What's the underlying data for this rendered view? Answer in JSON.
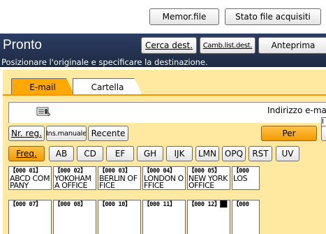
{
  "toolbar": {
    "memor_file": "Memor.file",
    "stato_file": "Stato file acquisiti"
  },
  "header": {
    "title": "Pronto",
    "instruction": "Posizionare l'originale e specificare la destinazione.",
    "cerca_dest": "Cerca dest.",
    "camb_list_dest": "Camb.list.dest.",
    "anteprima": "Anteprima"
  },
  "tabs": [
    {
      "label": "E-mail",
      "active": true
    },
    {
      "label": "Cartella",
      "active": false
    }
  ],
  "destination": {
    "address_label": "Indirizzo e-ma",
    "scroll_glyph": "I"
  },
  "actions": {
    "nr_reg": "Nr. reg.",
    "ins_manuale": "Ins.manuale",
    "recente": "Recente",
    "per": "Per"
  },
  "index_tabs": [
    "Freq.",
    "AB",
    "CD",
    "EF",
    "GH",
    "IJK",
    "LMN",
    "OPQ",
    "RST",
    "UV"
  ],
  "entries": [
    {
      "num": "【000 01】",
      "name": "ABCD COMPANY"
    },
    {
      "num": "【000 02】",
      "name": "YOKOHAMA OFFICE"
    },
    {
      "num": "【000 03】",
      "name": "BERLIN OFFICE"
    },
    {
      "num": "【000 04】",
      "name": "LONDON OFFICE"
    },
    {
      "num": "【000 05】",
      "name": "NEW YORK OFFICE"
    },
    {
      "num": "【000",
      "name": "LOS"
    },
    {
      "num": "【000 07】",
      "name": ""
    },
    {
      "num": "【000 08】",
      "name": ""
    },
    {
      "num": "【000 10】",
      "name": ""
    },
    {
      "num": "【000 11】",
      "name": ""
    },
    {
      "num": "【000 12】██",
      "name": ""
    },
    {
      "num": "【000",
      "name": ""
    }
  ],
  "colors": {
    "title_bar": "#24324f",
    "accent_orange": "#ffa800",
    "panel_yellow": "#ffe8a0"
  }
}
